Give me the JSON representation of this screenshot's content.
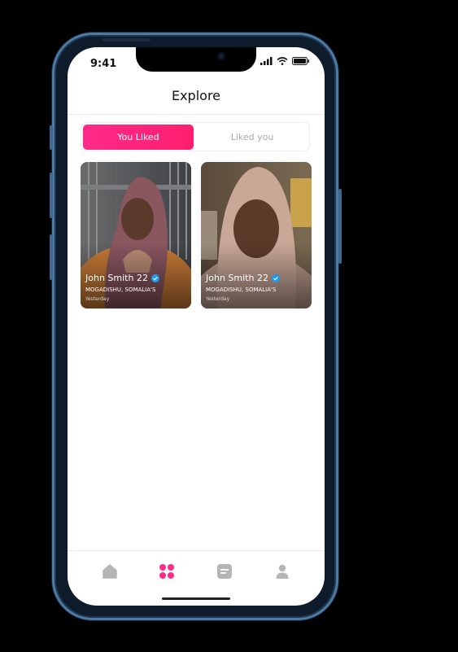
{
  "status_bar": {
    "time": "9:41"
  },
  "header": {
    "title": "Explore"
  },
  "segment": {
    "active_label": "You Liked",
    "inactive_label": "Liked you"
  },
  "cards": [
    {
      "name": "John Smith 22",
      "location": "MOGADISHU, SOMALIA'S",
      "time": "Yesterday"
    },
    {
      "name": "John Smith 22",
      "location": "MOGADISHU, SOMALIA'S",
      "time": "Yesterday"
    }
  ],
  "tabbar": {
    "items": [
      "home-icon",
      "grid-icon",
      "chat-icon",
      "profile-icon"
    ],
    "active_color": "#ff2a8a",
    "inactive_color": "#b5b5b5"
  },
  "colors": {
    "accent": "#ff2a8a",
    "verified": "#1e9bf0",
    "frame": "#4c7aa3"
  }
}
